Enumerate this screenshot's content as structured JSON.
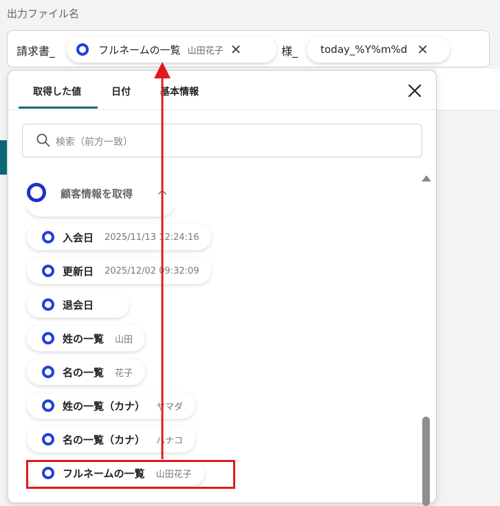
{
  "header": {
    "label": "出力ファイル名"
  },
  "filename": {
    "prefix": "請求書_",
    "chip1": {
      "name": "フルネームの一覧",
      "value": "山田花子"
    },
    "middle": "様_",
    "chip2": {
      "name": "today_%Y%m%d"
    }
  },
  "panel": {
    "tabs": [
      {
        "label": "取得した値"
      },
      {
        "label": "日付"
      },
      {
        "label": "基本情報"
      }
    ],
    "search": {
      "placeholder": "検索（前方一致）"
    },
    "group": {
      "label": "顧客情報を取得"
    },
    "fields": [
      {
        "name": "入会日",
        "value": "2025/11/13 12:24:16"
      },
      {
        "name": "更新日",
        "value": "2025/12/02 09:32:09"
      },
      {
        "name": "退会日",
        "value": ""
      },
      {
        "name": "姓の一覧",
        "value": "山田"
      },
      {
        "name": "名の一覧",
        "value": "花子"
      },
      {
        "name": "姓の一覧（カナ）",
        "value": "ヤマダ"
      },
      {
        "name": "名の一覧（カナ）",
        "value": "ハナコ"
      },
      {
        "name": "フルネームの一覧",
        "value": "山田花子"
      }
    ]
  },
  "colors": {
    "accent": "#0b6a78",
    "ring": "#2040d8",
    "annotation": "#e3181e"
  }
}
